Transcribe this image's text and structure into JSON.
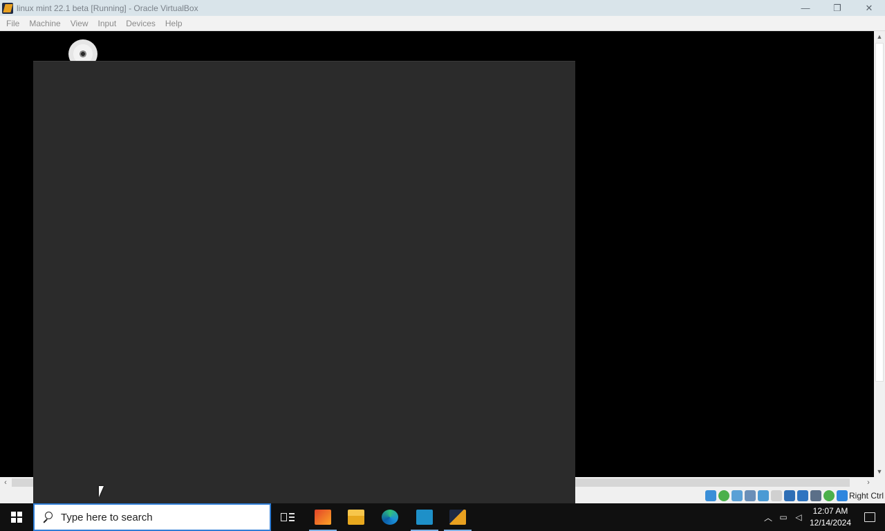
{
  "window": {
    "title": "linux mint 22.1 beta [Running] - Oracle VirtualBox",
    "minimize_glyph": "—",
    "restore_glyph": "❐",
    "close_glyph": "✕"
  },
  "menu": {
    "items": [
      "File",
      "Machine",
      "View",
      "Input",
      "Devices",
      "Help"
    ]
  },
  "vm": {
    "background": "#000000",
    "inner_window_color": "#2b2b2b",
    "icon": "optical-disc-icon"
  },
  "statusbar": {
    "host_key": "Right Ctrl",
    "icons": [
      "hard-disk-icon",
      "optical-drive-icon",
      "audio-icon",
      "network-icon",
      "usb-icon",
      "shared-folders-icon",
      "display-icon",
      "recording-icon",
      "cpu-icon",
      "mouse-integration-icon",
      "keyboard-icon",
      "download-icon"
    ]
  },
  "taskbar": {
    "search_placeholder": "Type here to search",
    "apps": [
      "task-view-icon",
      "gitlab-icon",
      "file-explorer-icon",
      "edge-icon",
      "vscode-icon",
      "virtualbox-icon"
    ],
    "clock_time": "12:07 AM",
    "clock_date": "12/14/2024"
  },
  "colors": {
    "titlebar": "#d9e4ea",
    "search_border": "#2e7dd6",
    "taskbar": "#101010"
  }
}
